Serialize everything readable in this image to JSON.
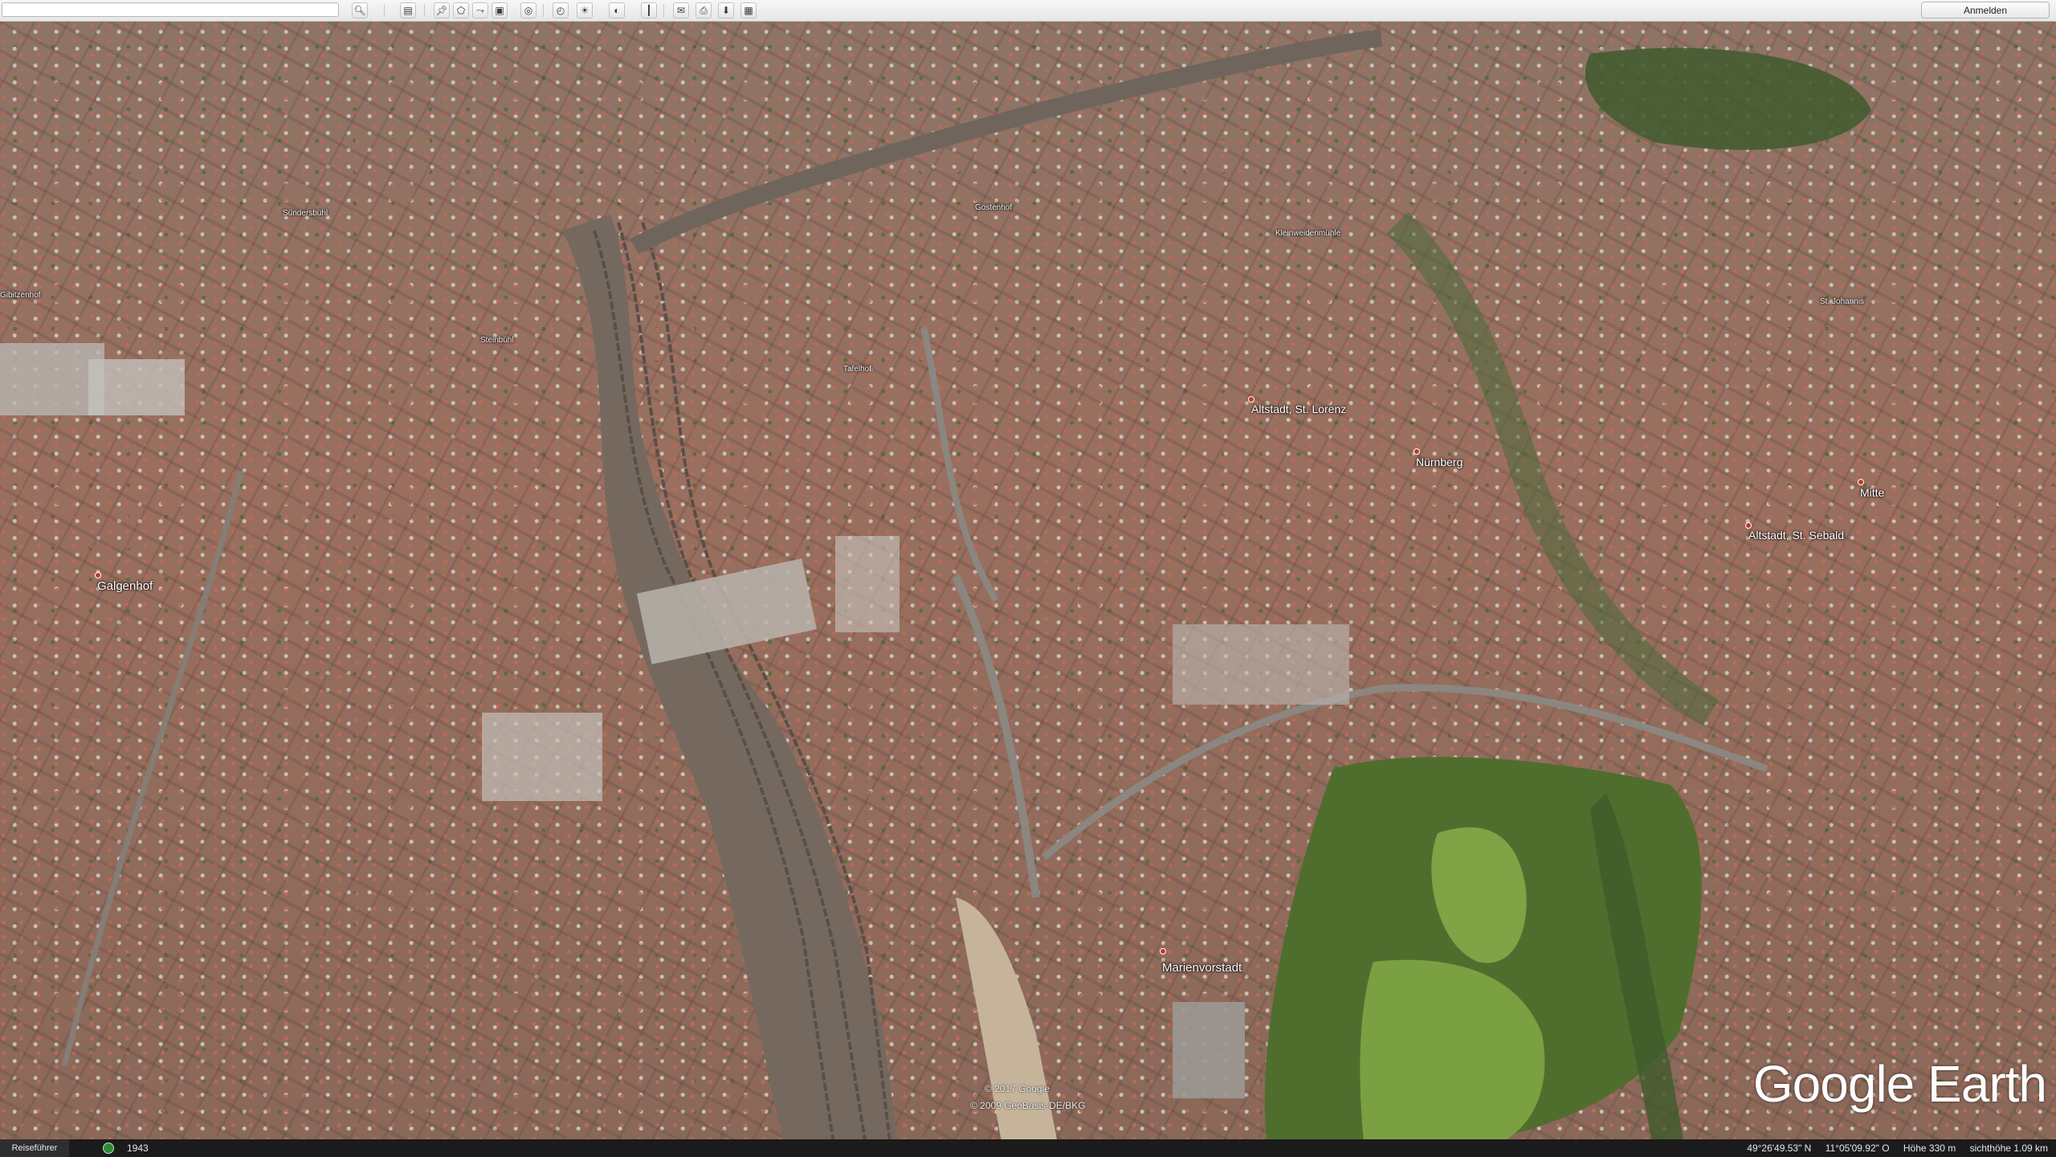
{
  "toolbar": {
    "search_placeholder": "",
    "signin_label": "Anmelden",
    "buttons": [
      "search-icon",
      "sidebar-icon",
      "placemark-icon",
      "polygon-icon",
      "path-icon",
      "overlay-icon",
      "tour-icon",
      "sun-icon",
      "historical-icon",
      "planets-icon",
      "ruler-icon",
      "email-icon",
      "print-icon",
      "save-image-icon",
      "maps-icon"
    ]
  },
  "map": {
    "labels": {
      "galgenhof": "Galgenhof",
      "marienvorstadt": "Marienvorstadt",
      "altstadt_lorenz": "Altstadt, St. Lorenz",
      "nurnberg": "Nürnberg",
      "mitte": "Mitte",
      "altstadt_sebald": "Altstadt, St. Sebald",
      "tafelhof": "Tafelhof",
      "steinbuhl": "Steinbühl",
      "gibitzenhof": "Gibitzenhof",
      "sundersbuhl": "Sündersbühl",
      "st_johannis": "St. Johannis",
      "gostenhof": "Gostenhof",
      "kleinweidenmuhle": "Kleinweidenmühle"
    },
    "attribution": [
      "© 2017 Google",
      "© 2009 GeoBasis-DE/BKG"
    ],
    "logo": "Google Earth"
  },
  "statusbar": {
    "tour_label": "Reiseführer",
    "year": "1943",
    "latitude": "49°26'49.53\" N",
    "longitude": "11°05'09.92\" O",
    "elevation": "Höhe  330 m",
    "eye_altitude": "sichthöhe  1.09 km"
  },
  "colors": {
    "roofs": "#b4604d",
    "park": "#6f8f3e",
    "rail": "#6d6259"
  }
}
